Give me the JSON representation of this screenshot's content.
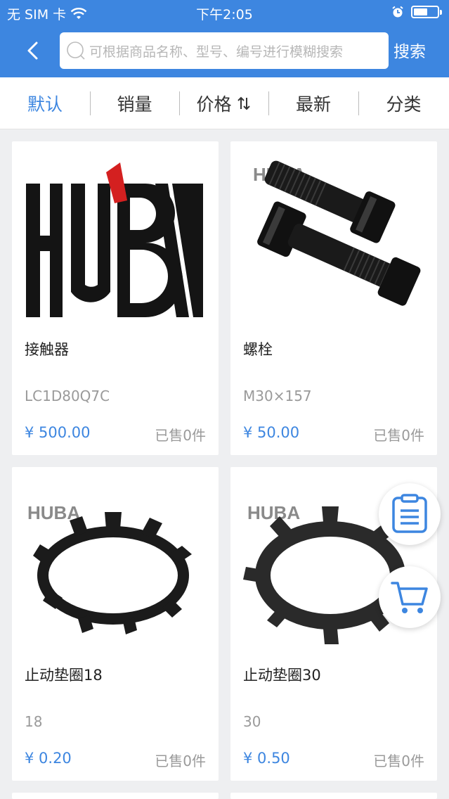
{
  "status_bar": {
    "carrier": "无 SIM 卡",
    "time": "下午2:05",
    "battery_level": 0.55
  },
  "header": {
    "search_placeholder": "可根据商品名称、型号、编号进行模糊搜索",
    "search_button": "搜索"
  },
  "sort_tabs": [
    {
      "label": "默认",
      "active": true
    },
    {
      "label": "销量",
      "active": false
    },
    {
      "label": "价格",
      "active": false
    },
    {
      "label": "最新",
      "active": false
    },
    {
      "label": "分类",
      "active": false
    }
  ],
  "brand_logo_text": "HUBA",
  "products": [
    {
      "name": "接触器",
      "model": "LC1D80Q7C",
      "price": "¥ 500.00",
      "sold": "已售0件",
      "image": "huba-logo"
    },
    {
      "name": "螺栓",
      "model": "M30×157",
      "price": "¥ 50.00",
      "sold": "已售0件",
      "image": "bolts"
    },
    {
      "name": "止动垫圈18",
      "model": "18",
      "price": "¥ 0.20",
      "sold": "已售0件",
      "image": "tab-washer"
    },
    {
      "name": "止动垫圈30",
      "model": "30",
      "price": "¥ 0.50",
      "sold": "已售0件",
      "image": "tab-washer"
    }
  ],
  "floating_buttons": [
    {
      "icon": "order-list-icon"
    },
    {
      "icon": "shopping-cart-icon"
    }
  ],
  "colors": {
    "accent": "#3d86e0",
    "background": "#eeeff1"
  }
}
